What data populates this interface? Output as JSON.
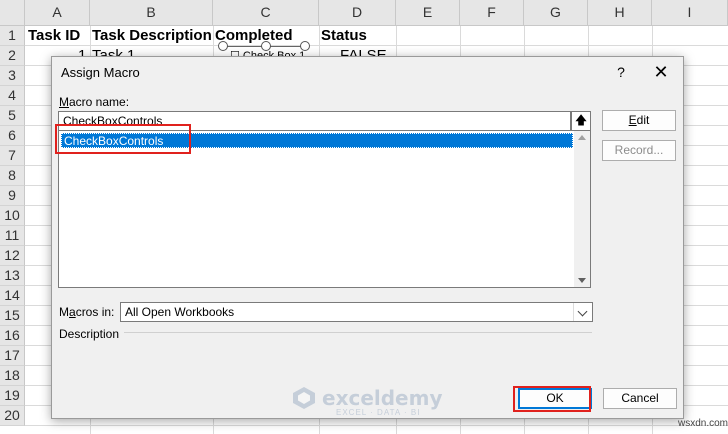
{
  "sheet": {
    "columns": [
      "A",
      "B",
      "C",
      "D",
      "E",
      "F",
      "G",
      "H",
      "I"
    ],
    "rows": [
      "1",
      "2",
      "3",
      "4",
      "5",
      "6",
      "7",
      "8",
      "9",
      "10",
      "11",
      "12",
      "13",
      "14",
      "15",
      "16",
      "17",
      "18",
      "19",
      "20"
    ],
    "headers": {
      "a": "Task ID",
      "b": "Task Description",
      "c": "Completed",
      "d": "Status"
    },
    "row2": {
      "a": "1",
      "b": "Task 1",
      "c": "Check Box 1",
      "d": "FALSE"
    }
  },
  "dialog": {
    "title": "Assign Macro",
    "help": "?",
    "close": "✕",
    "macro_name_label_key": "M",
    "macro_name_label_rest": "acro name:",
    "macro_name_value": "CheckBoxControls",
    "up_button": "🡅",
    "list_items": [
      "CheckBoxControls"
    ],
    "edit_button_key": "E",
    "edit_button_rest": "dit",
    "record_button": "Record...",
    "macros_in_label_a": "M",
    "macros_in_label_key": "a",
    "macros_in_label_rest": "cros in:",
    "macros_in_value": "All Open Workbooks",
    "description_label": "Description",
    "ok_button": "OK",
    "cancel_button": "Cancel"
  },
  "watermark": {
    "brand": "exceldemy",
    "tagline": "EXCEL · DATA · BI",
    "site": "wsxdn.com"
  },
  "colors": {
    "selection": "#0078d7",
    "highlight": "#e0211d"
  }
}
